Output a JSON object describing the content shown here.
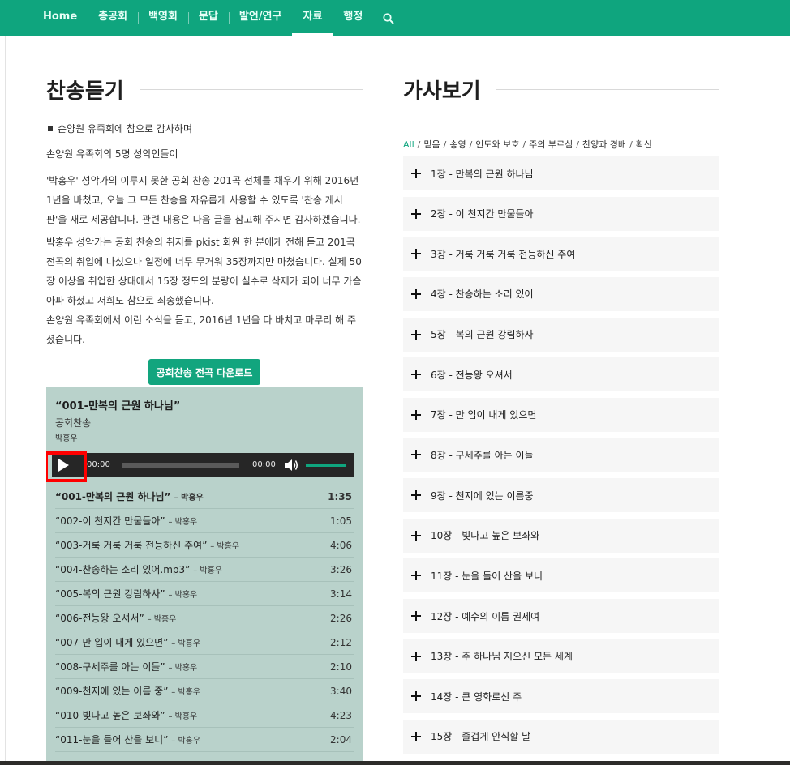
{
  "nav": {
    "items": [
      "Home",
      "총공회",
      "백영회",
      "문답",
      "발언/연구",
      "자료",
      "행정"
    ],
    "active_index": 5
  },
  "left": {
    "title": "찬송듣기",
    "bullet_text": "손양원 유족회에 참으로 감사하며",
    "paragraphs": [
      "손양원 유족회의 5명 성악인들이",
      "'박홍우' 성악가의 이루지 못한 공회 찬송 201곡 전체를 채우기 위해 2016년 1년을 바쳤고, 오늘 그 모든 찬송을 자유롭게 사용할 수 있도록 '찬송 게시판'을 새로 제공합니다. 관련 내용은 다음 글을 참고해 주시면 감사하겠습니다.",
      "박홍우 성악가는 공회 찬송의 취지를 pkist 회원 한 분에게 전해 듣고 201곡 전곡의 취입에 나섰으나 일정에 너무 무거워 35장까지만 마쳤습니다. 실제 50장 이상을 취입한 상태에서 15장 정도의 분량이 실수로 삭제가 되어 너무 가슴 아파 하셨고 저희도 참으로 죄송했습니다.",
      "손양원 유족회에서 이런 소식을 듣고, 2016년 1년을 다 바치고 마무리 해 주셨습니다."
    ],
    "download_label": "공회찬송 전곡 다운로드"
  },
  "player": {
    "title": "“001-만복의 근원 하나님”",
    "album": "공회찬송",
    "artist": "박홍우",
    "current_time": "00:00",
    "duration": "00:00",
    "progress": 0,
    "volume": 1.0,
    "tracks": [
      {
        "title": "“001-만복의 근원 하나님”",
        "artist": "– 박홍우",
        "duration": "1:35"
      },
      {
        "title": "“002-이 천지간 만물들아”",
        "artist": "– 박홍우",
        "duration": "1:05"
      },
      {
        "title": "“003-거룩 거룩 거룩 전능하신 주여”",
        "artist": "– 박홍우",
        "duration": "4:06"
      },
      {
        "title": "“004-찬송하는 소리 있어.mp3”",
        "artist": "– 박홍우",
        "duration": "3:26"
      },
      {
        "title": "“005-복의 근원 강림하사”",
        "artist": "– 박홍우",
        "duration": "3:14"
      },
      {
        "title": "“006-전능왕 오셔서”",
        "artist": "– 박홍우",
        "duration": "2:26"
      },
      {
        "title": "“007-만 입이 내게 있으면”",
        "artist": "– 박홍우",
        "duration": "2:12"
      },
      {
        "title": "“008-구세주를 아는 이들”",
        "artist": "– 박홍우",
        "duration": "2:10"
      },
      {
        "title": "“009-천지에 있는 이름 중”",
        "artist": "– 박홍우",
        "duration": "3:40"
      },
      {
        "title": "“010-빛나고 높은 보좌와”",
        "artist": "– 박홍우",
        "duration": "4:23"
      },
      {
        "title": "“011-눈을 들어 산을 보니”",
        "artist": "– 박홍우",
        "duration": "2:04"
      }
    ]
  },
  "right": {
    "title": "가사보기",
    "filters": [
      "All",
      "믿음",
      "송영",
      "인도와 보호",
      "주의 부르심",
      "찬양과 경배",
      "확신"
    ],
    "active_filter": "All",
    "songs": [
      "1장 - 만복의 근원 하나님",
      "2장 - 이 천지간 만물들아",
      "3장 - 거룩 거룩 거룩 전능하신 주여",
      "4장 - 찬송하는 소리 있어",
      "5장 - 복의 근원 강림하사",
      "6장 - 전능왕 오셔서",
      "7장 - 만 입이 내게 있으면",
      "8장 - 구세주를 아는 이들",
      "9장 - 천지에 있는 이름중",
      "10장 - 빛나고 높은 보좌와",
      "11장 - 눈을 들어 산을 보니",
      "12장 - 예수의 이름 권세여",
      "13장 - 주 하나님 지으신 모든 세계",
      "14장 - 큰 영화로신 주",
      "15장 - 즐겁게 안식할 날"
    ]
  },
  "colors": {
    "brand": "#0fa57e",
    "player_bg": "#b9d2cb",
    "highlight": "#ff0000"
  }
}
